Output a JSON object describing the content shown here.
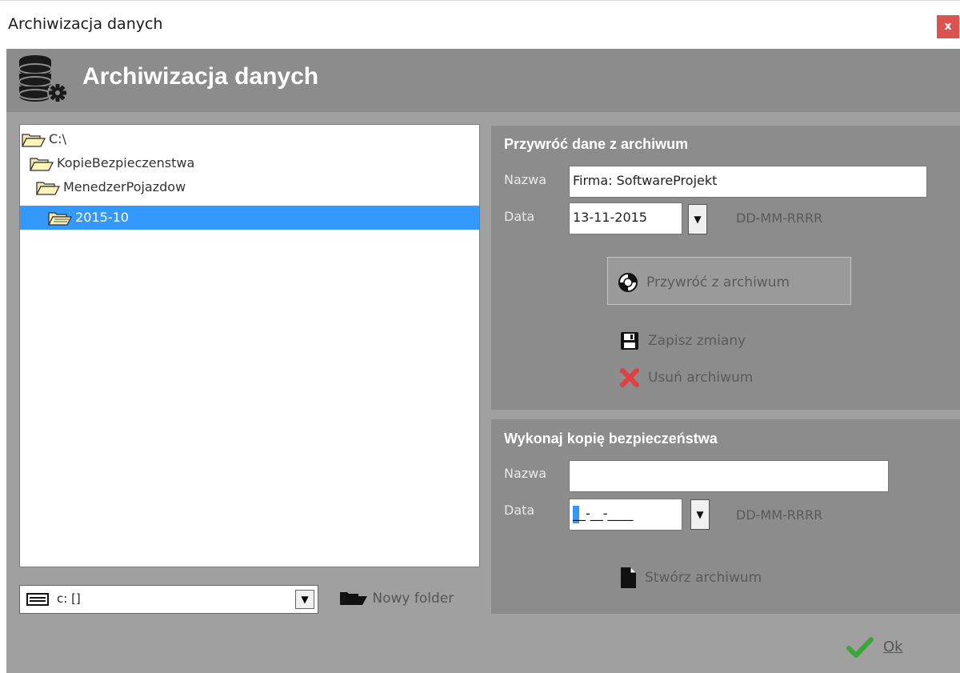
{
  "window": {
    "title": "Archiwizacja danych",
    "close_label": "x"
  },
  "banner": {
    "heading": "Archiwizacja danych",
    "icon": "database-gear-icon"
  },
  "tree": {
    "items": [
      {
        "label": "C:\\",
        "icon": "folder-open-icon"
      },
      {
        "label": "KopieBezpieczenstwa",
        "icon": "folder-open-icon"
      },
      {
        "label": "MenedzerPojazdow",
        "icon": "folder-open-icon"
      },
      {
        "label": "2015-10",
        "icon": "folder-open-icon",
        "selected": true
      }
    ]
  },
  "drive": {
    "value": "c: []",
    "icon": "drive-icon"
  },
  "new_folder": {
    "label": "Nowy folder",
    "icon": "folder-open-icon"
  },
  "restore": {
    "title": "Przywróć dane z archiwum",
    "name_label": "Nazwa",
    "name_value": "Firma: SoftwareProjekt",
    "date_label": "Data",
    "date_value": "13-11-2015",
    "date_format": "DD-MM-RRRR",
    "restore_button": "Przywróć z archiwum",
    "save_button": "Zapisz zmiany",
    "delete_button": "Usuń archiwum"
  },
  "backup": {
    "title": "Wykonaj kopię bezpieczeństwa",
    "name_label": "Nazwa",
    "name_value": "",
    "date_label": "Data",
    "date_value": "__-__-____",
    "date_format": "DD-MM-RRRR",
    "create_button": "Stwórz archiwum"
  },
  "footer": {
    "ok_label": "Ok"
  },
  "colors": {
    "banner": "#8c8c8c",
    "body": "#a0a0a0",
    "selection": "#3399ff",
    "close": "#d9534f",
    "ok_check": "#3aa63a",
    "delete_x": "#e04040"
  }
}
